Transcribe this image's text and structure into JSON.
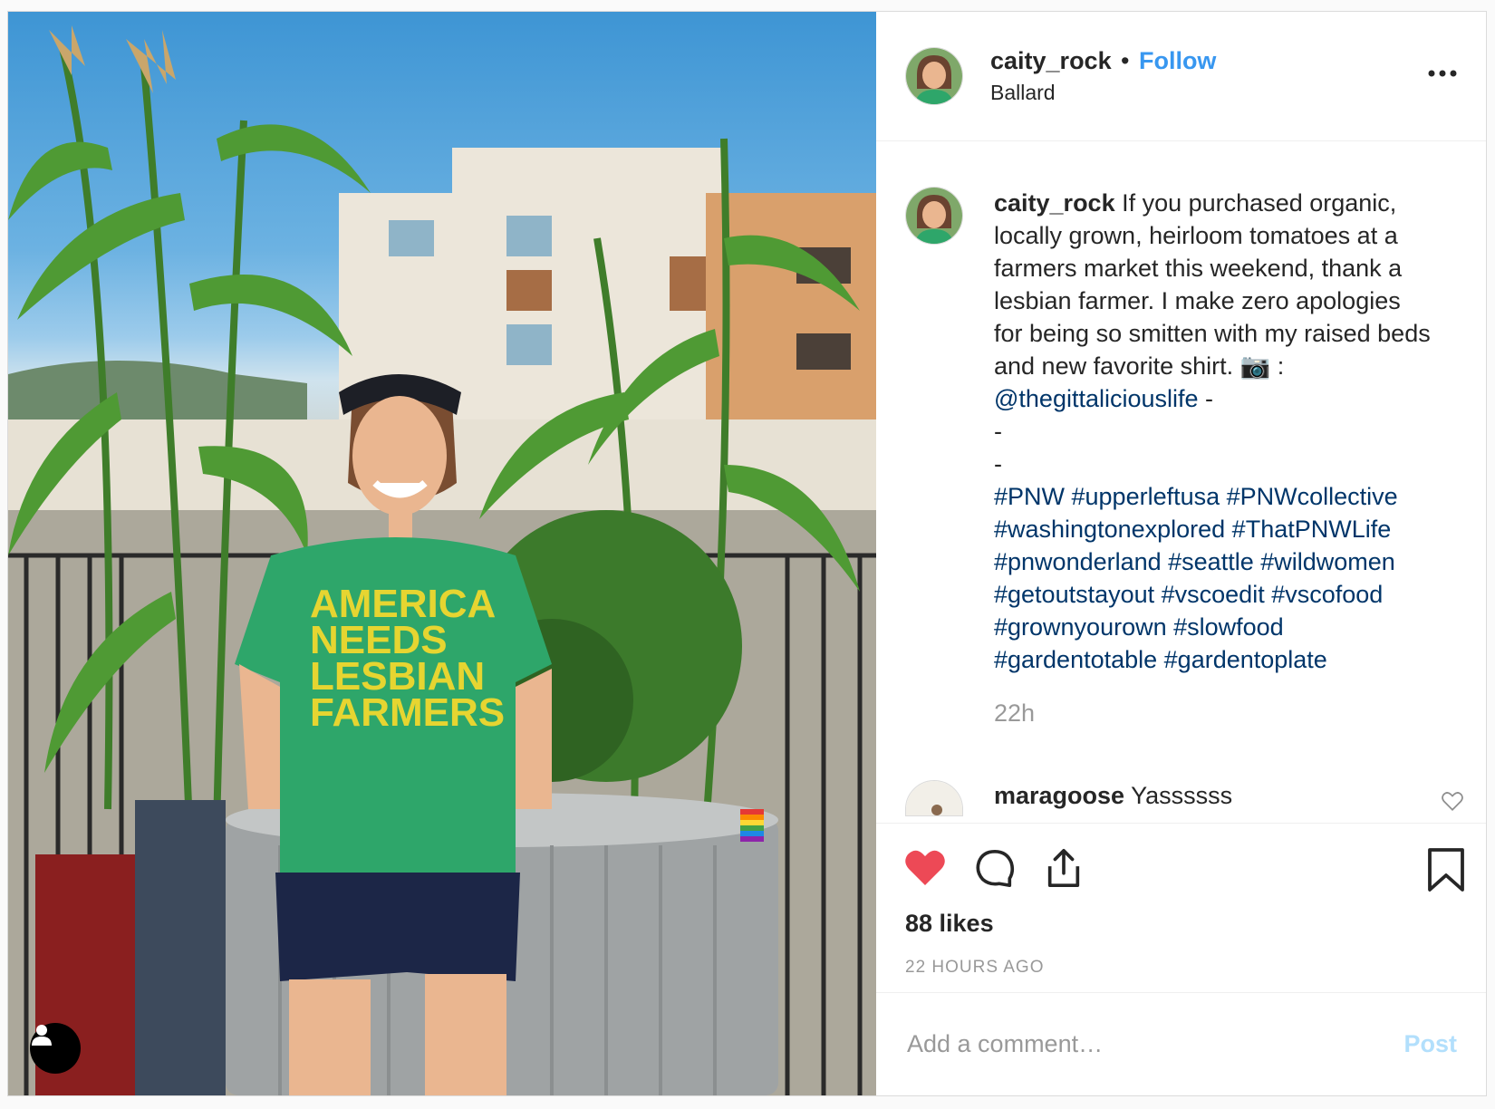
{
  "photo": {
    "shirt_text_lines": [
      "AMERICA",
      "NEEDS",
      "LESBIAN",
      "FARMERS"
    ],
    "user_icon": "user-icon"
  },
  "header": {
    "username": "caity_rock",
    "separator": "•",
    "follow_label": "Follow",
    "location": "Ballard",
    "more_icon": "more-options-icon"
  },
  "caption": {
    "username": "caity_rock",
    "text_before_mention": " If you purchased organic, locally grown, heirloom tomatoes at a farmers market this weekend, thank a lesbian farmer. I make zero apologies for being so smitten with my raised beds and new favorite shirt. 📷 : ",
    "mention": "@thegittaliciouslife",
    "text_after_mention": " -\n-\n-\n",
    "hashtags": "#PNW #upperleftusa #PNWcollective #washingtonexplored #ThatPNWLife #pnwonderland #seattle #wildwomen #getoutstayout #vscoedit #vscofood #grownyourown #slowfood #gardentotable #gardentoplate",
    "time": "22h"
  },
  "comment": {
    "username": "maragoose",
    "text": " Yassssss"
  },
  "actions": {
    "likes": "88 likes",
    "timestamp": "22 HOURS AGO",
    "like_color": "#ed4956"
  },
  "add_comment": {
    "placeholder": "Add a comment…",
    "post_label": "Post"
  }
}
